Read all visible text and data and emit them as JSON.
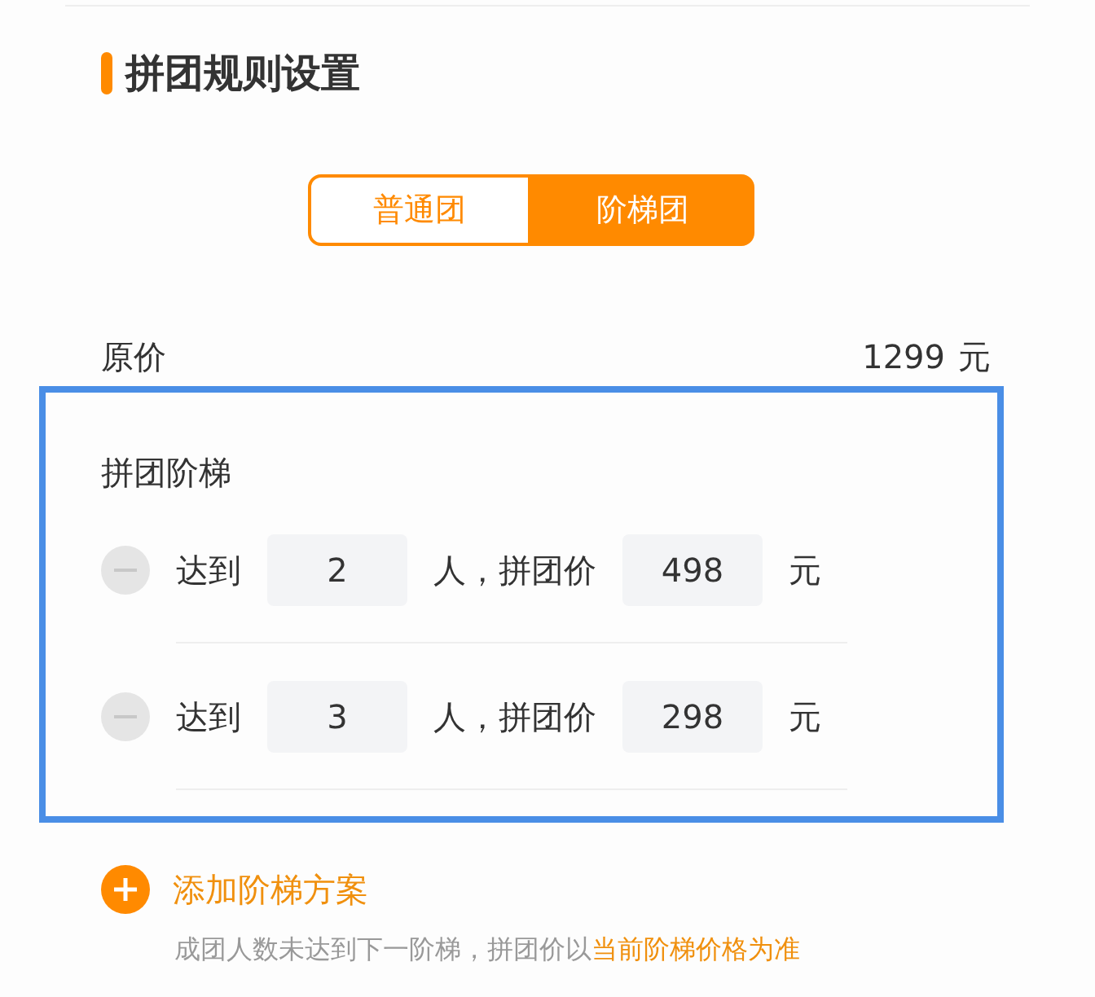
{
  "section_title": "拼团规则设置",
  "tabs": [
    {
      "label": "普通团",
      "selected": false
    },
    {
      "label": "阶梯团",
      "selected": true
    }
  ],
  "original_price": {
    "label": "原价",
    "value": "1299",
    "unit": "元"
  },
  "tiers": {
    "title": "拼团阶梯",
    "rows": [
      {
        "prefix": "达到",
        "people": "2",
        "middle": "人，拼团价",
        "price": "498",
        "unit": "元"
      },
      {
        "prefix": "达到",
        "people": "3",
        "middle": "人，拼团价",
        "price": "298",
        "unit": "元"
      }
    ]
  },
  "add_button": {
    "label": "添加阶梯方案"
  },
  "note": {
    "text": "成团人数未达到下一阶梯，拼团价以",
    "emphasis": "当前阶梯价格为准"
  }
}
